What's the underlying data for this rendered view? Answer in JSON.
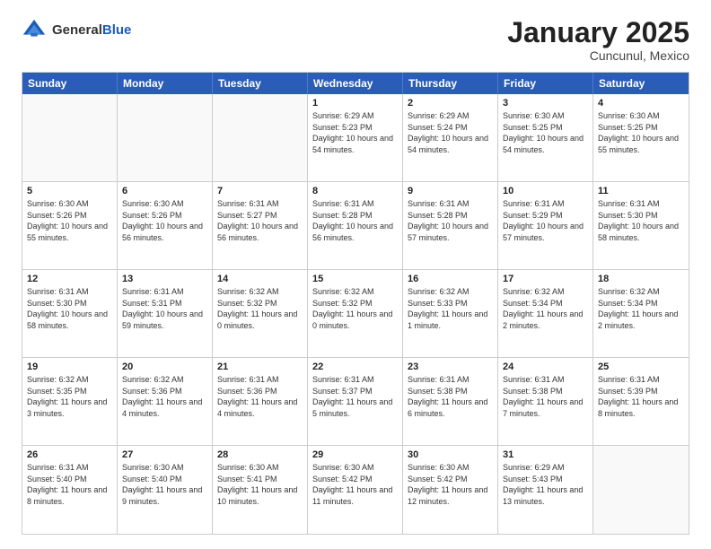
{
  "logo": {
    "general": "General",
    "blue": "Blue"
  },
  "header": {
    "month": "January 2025",
    "location": "Cuncunul, Mexico"
  },
  "weekdays": [
    "Sunday",
    "Monday",
    "Tuesday",
    "Wednesday",
    "Thursday",
    "Friday",
    "Saturday"
  ],
  "weeks": [
    [
      {
        "day": "",
        "empty": true
      },
      {
        "day": "",
        "empty": true
      },
      {
        "day": "",
        "empty": true
      },
      {
        "day": "1",
        "sunrise": "6:29 AM",
        "sunset": "5:23 PM",
        "daylight": "10 hours and 54 minutes."
      },
      {
        "day": "2",
        "sunrise": "6:29 AM",
        "sunset": "5:24 PM",
        "daylight": "10 hours and 54 minutes."
      },
      {
        "day": "3",
        "sunrise": "6:30 AM",
        "sunset": "5:25 PM",
        "daylight": "10 hours and 54 minutes."
      },
      {
        "day": "4",
        "sunrise": "6:30 AM",
        "sunset": "5:25 PM",
        "daylight": "10 hours and 55 minutes."
      }
    ],
    [
      {
        "day": "5",
        "sunrise": "6:30 AM",
        "sunset": "5:26 PM",
        "daylight": "10 hours and 55 minutes."
      },
      {
        "day": "6",
        "sunrise": "6:30 AM",
        "sunset": "5:26 PM",
        "daylight": "10 hours and 56 minutes."
      },
      {
        "day": "7",
        "sunrise": "6:31 AM",
        "sunset": "5:27 PM",
        "daylight": "10 hours and 56 minutes."
      },
      {
        "day": "8",
        "sunrise": "6:31 AM",
        "sunset": "5:28 PM",
        "daylight": "10 hours and 56 minutes."
      },
      {
        "day": "9",
        "sunrise": "6:31 AM",
        "sunset": "5:28 PM",
        "daylight": "10 hours and 57 minutes."
      },
      {
        "day": "10",
        "sunrise": "6:31 AM",
        "sunset": "5:29 PM",
        "daylight": "10 hours and 57 minutes."
      },
      {
        "day": "11",
        "sunrise": "6:31 AM",
        "sunset": "5:30 PM",
        "daylight": "10 hours and 58 minutes."
      }
    ],
    [
      {
        "day": "12",
        "sunrise": "6:31 AM",
        "sunset": "5:30 PM",
        "daylight": "10 hours and 58 minutes."
      },
      {
        "day": "13",
        "sunrise": "6:31 AM",
        "sunset": "5:31 PM",
        "daylight": "10 hours and 59 minutes."
      },
      {
        "day": "14",
        "sunrise": "6:32 AM",
        "sunset": "5:32 PM",
        "daylight": "11 hours and 0 minutes."
      },
      {
        "day": "15",
        "sunrise": "6:32 AM",
        "sunset": "5:32 PM",
        "daylight": "11 hours and 0 minutes."
      },
      {
        "day": "16",
        "sunrise": "6:32 AM",
        "sunset": "5:33 PM",
        "daylight": "11 hours and 1 minute."
      },
      {
        "day": "17",
        "sunrise": "6:32 AM",
        "sunset": "5:34 PM",
        "daylight": "11 hours and 2 minutes."
      },
      {
        "day": "18",
        "sunrise": "6:32 AM",
        "sunset": "5:34 PM",
        "daylight": "11 hours and 2 minutes."
      }
    ],
    [
      {
        "day": "19",
        "sunrise": "6:32 AM",
        "sunset": "5:35 PM",
        "daylight": "11 hours and 3 minutes."
      },
      {
        "day": "20",
        "sunrise": "6:32 AM",
        "sunset": "5:36 PM",
        "daylight": "11 hours and 4 minutes."
      },
      {
        "day": "21",
        "sunrise": "6:31 AM",
        "sunset": "5:36 PM",
        "daylight": "11 hours and 4 minutes."
      },
      {
        "day": "22",
        "sunrise": "6:31 AM",
        "sunset": "5:37 PM",
        "daylight": "11 hours and 5 minutes."
      },
      {
        "day": "23",
        "sunrise": "6:31 AM",
        "sunset": "5:38 PM",
        "daylight": "11 hours and 6 minutes."
      },
      {
        "day": "24",
        "sunrise": "6:31 AM",
        "sunset": "5:38 PM",
        "daylight": "11 hours and 7 minutes."
      },
      {
        "day": "25",
        "sunrise": "6:31 AM",
        "sunset": "5:39 PM",
        "daylight": "11 hours and 8 minutes."
      }
    ],
    [
      {
        "day": "26",
        "sunrise": "6:31 AM",
        "sunset": "5:40 PM",
        "daylight": "11 hours and 8 minutes."
      },
      {
        "day": "27",
        "sunrise": "6:30 AM",
        "sunset": "5:40 PM",
        "daylight": "11 hours and 9 minutes."
      },
      {
        "day": "28",
        "sunrise": "6:30 AM",
        "sunset": "5:41 PM",
        "daylight": "11 hours and 10 minutes."
      },
      {
        "day": "29",
        "sunrise": "6:30 AM",
        "sunset": "5:42 PM",
        "daylight": "11 hours and 11 minutes."
      },
      {
        "day": "30",
        "sunrise": "6:30 AM",
        "sunset": "5:42 PM",
        "daylight": "11 hours and 12 minutes."
      },
      {
        "day": "31",
        "sunrise": "6:29 AM",
        "sunset": "5:43 PM",
        "daylight": "11 hours and 13 minutes."
      },
      {
        "day": "",
        "empty": true
      }
    ]
  ],
  "labels": {
    "sunrise_prefix": "Sunrise: ",
    "sunset_prefix": "Sunset: ",
    "daylight_prefix": "Daylight: "
  }
}
